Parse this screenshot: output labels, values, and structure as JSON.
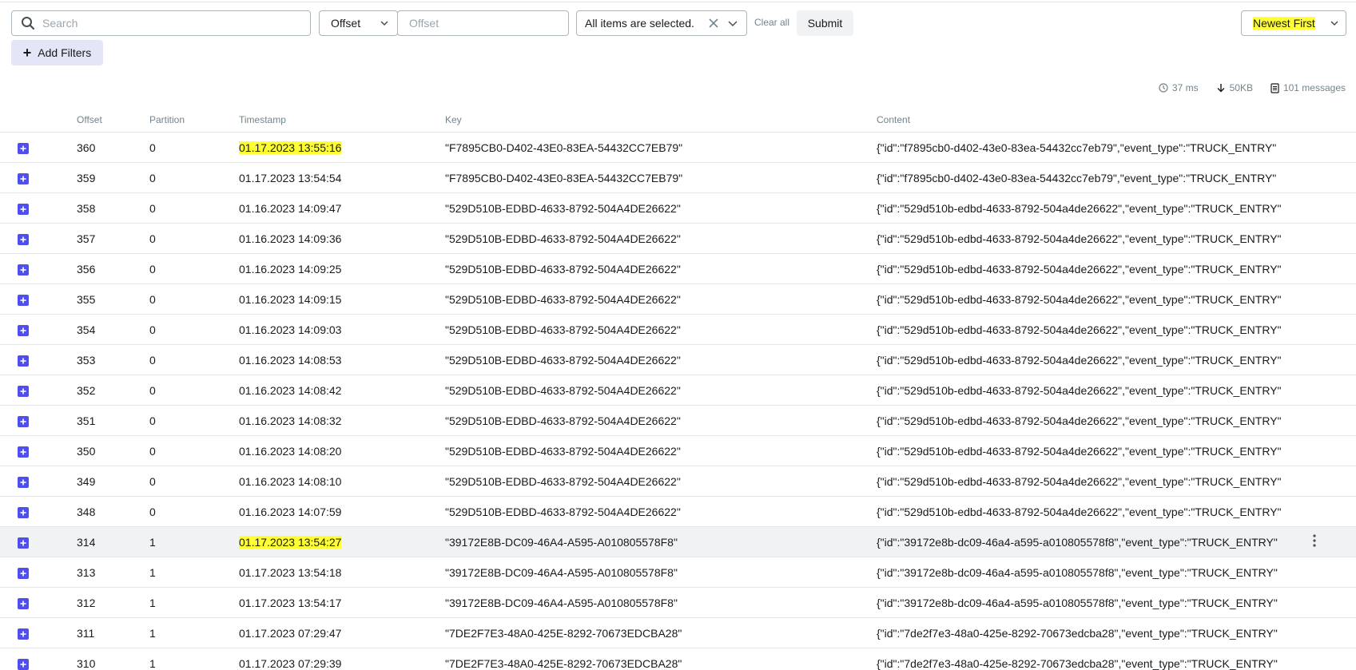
{
  "toolbar": {
    "search_placeholder": "Search",
    "seek_type": "Offset",
    "offset_placeholder": "Offset",
    "partitions_label": "All items are selected.",
    "clear_all_label": "Clear all",
    "submit_label": "Submit",
    "sort_label": "Newest First",
    "add_filters_label": "Add Filters"
  },
  "stats": {
    "elapsed": "37 ms",
    "bytes": "50KB",
    "messages": "101 messages"
  },
  "table": {
    "columns": [
      "Offset",
      "Partition",
      "Timestamp",
      "Key",
      "Content"
    ],
    "rows": [
      {
        "offset": "360",
        "partition": "0",
        "timestamp": "01.17.2023 13:55:16",
        "key": "\"F7895CB0-D402-43E0-83EA-54432CC7EB79\"",
        "content": "{\"id\":\"f7895cb0-d402-43e0-83ea-54432cc7eb79\",\"event_type\":\"TRUCK_ENTRY\"",
        "highlighted": true
      },
      {
        "offset": "359",
        "partition": "0",
        "timestamp": "01.17.2023 13:54:54",
        "key": "\"F7895CB0-D402-43E0-83EA-54432CC7EB79\"",
        "content": "{\"id\":\"f7895cb0-d402-43e0-83ea-54432cc7eb79\",\"event_type\":\"TRUCK_ENTRY\""
      },
      {
        "offset": "358",
        "partition": "0",
        "timestamp": "01.16.2023 14:09:47",
        "key": "\"529D510B-EDBD-4633-8792-504A4DE26622\"",
        "content": "{\"id\":\"529d510b-edbd-4633-8792-504a4de26622\",\"event_type\":\"TRUCK_ENTRY\""
      },
      {
        "offset": "357",
        "partition": "0",
        "timestamp": "01.16.2023 14:09:36",
        "key": "\"529D510B-EDBD-4633-8792-504A4DE26622\"",
        "content": "{\"id\":\"529d510b-edbd-4633-8792-504a4de26622\",\"event_type\":\"TRUCK_ENTRY\""
      },
      {
        "offset": "356",
        "partition": "0",
        "timestamp": "01.16.2023 14:09:25",
        "key": "\"529D510B-EDBD-4633-8792-504A4DE26622\"",
        "content": "{\"id\":\"529d510b-edbd-4633-8792-504a4de26622\",\"event_type\":\"TRUCK_ENTRY\""
      },
      {
        "offset": "355",
        "partition": "0",
        "timestamp": "01.16.2023 14:09:15",
        "key": "\"529D510B-EDBD-4633-8792-504A4DE26622\"",
        "content": "{\"id\":\"529d510b-edbd-4633-8792-504a4de26622\",\"event_type\":\"TRUCK_ENTRY\""
      },
      {
        "offset": "354",
        "partition": "0",
        "timestamp": "01.16.2023 14:09:03",
        "key": "\"529D510B-EDBD-4633-8792-504A4DE26622\"",
        "content": "{\"id\":\"529d510b-edbd-4633-8792-504a4de26622\",\"event_type\":\"TRUCK_ENTRY\""
      },
      {
        "offset": "353",
        "partition": "0",
        "timestamp": "01.16.2023 14:08:53",
        "key": "\"529D510B-EDBD-4633-8792-504A4DE26622\"",
        "content": "{\"id\":\"529d510b-edbd-4633-8792-504a4de26622\",\"event_type\":\"TRUCK_ENTRY\""
      },
      {
        "offset": "352",
        "partition": "0",
        "timestamp": "01.16.2023 14:08:42",
        "key": "\"529D510B-EDBD-4633-8792-504A4DE26622\"",
        "content": "{\"id\":\"529d510b-edbd-4633-8792-504a4de26622\",\"event_type\":\"TRUCK_ENTRY\""
      },
      {
        "offset": "351",
        "partition": "0",
        "timestamp": "01.16.2023 14:08:32",
        "key": "\"529D510B-EDBD-4633-8792-504A4DE26622\"",
        "content": "{\"id\":\"529d510b-edbd-4633-8792-504a4de26622\",\"event_type\":\"TRUCK_ENTRY\""
      },
      {
        "offset": "350",
        "partition": "0",
        "timestamp": "01.16.2023 14:08:20",
        "key": "\"529D510B-EDBD-4633-8792-504A4DE26622\"",
        "content": "{\"id\":\"529d510b-edbd-4633-8792-504a4de26622\",\"event_type\":\"TRUCK_ENTRY\""
      },
      {
        "offset": "349",
        "partition": "0",
        "timestamp": "01.16.2023 14:08:10",
        "key": "\"529D510B-EDBD-4633-8792-504A4DE26622\"",
        "content": "{\"id\":\"529d510b-edbd-4633-8792-504a4de26622\",\"event_type\":\"TRUCK_ENTRY\""
      },
      {
        "offset": "348",
        "partition": "0",
        "timestamp": "01.16.2023 14:07:59",
        "key": "\"529D510B-EDBD-4633-8792-504A4DE26622\"",
        "content": "{\"id\":\"529d510b-edbd-4633-8792-504a4de26622\",\"event_type\":\"TRUCK_ENTRY\""
      },
      {
        "offset": "314",
        "partition": "1",
        "timestamp": "01.17.2023 13:54:27",
        "key": "\"39172E8B-DC09-46A4-A595-A010805578F8\"",
        "content": "{\"id\":\"39172e8b-dc09-46a4-a595-a010805578f8\",\"event_type\":\"TRUCK_ENTRY\"",
        "highlighted": true,
        "hover": true
      },
      {
        "offset": "313",
        "partition": "1",
        "timestamp": "01.17.2023 13:54:18",
        "key": "\"39172E8B-DC09-46A4-A595-A010805578F8\"",
        "content": "{\"id\":\"39172e8b-dc09-46a4-a595-a010805578f8\",\"event_type\":\"TRUCK_ENTRY\""
      },
      {
        "offset": "312",
        "partition": "1",
        "timestamp": "01.17.2023 13:54:17",
        "key": "\"39172E8B-DC09-46A4-A595-A010805578F8\"",
        "content": "{\"id\":\"39172e8b-dc09-46a4-a595-a010805578f8\",\"event_type\":\"TRUCK_ENTRY\""
      },
      {
        "offset": "311",
        "partition": "1",
        "timestamp": "01.17.2023 07:29:47",
        "key": "\"7DE2F7E3-48A0-425E-8292-70673EDCBA28\"",
        "content": "{\"id\":\"7de2f7e3-48a0-425e-8292-70673edcba28\",\"event_type\":\"TRUCK_ENTRY\""
      },
      {
        "offset": "310",
        "partition": "1",
        "timestamp": "01.17.2023 07:29:39",
        "key": "\"7DE2F7E3-48A0-425E-8292-70673EDCBA28\"",
        "content": "{\"id\":\"7de2f7e3-48a0-425e-8292-70673edcba28\",\"event_type\":\"TRUCK_ENTRY\""
      }
    ]
  },
  "colors": {
    "accent": "#4f4ff0",
    "highlight": "#ffff33",
    "muted_text": "#73848c"
  },
  "icons": {
    "search": "search-icon",
    "chevron": "chevron-down-icon",
    "clear": "close-icon",
    "expand": "plus-icon",
    "row_menu": "kebab-menu-icon",
    "elapsed": "clock-icon",
    "bytes": "arrow-down-icon",
    "messages": "document-icon"
  }
}
